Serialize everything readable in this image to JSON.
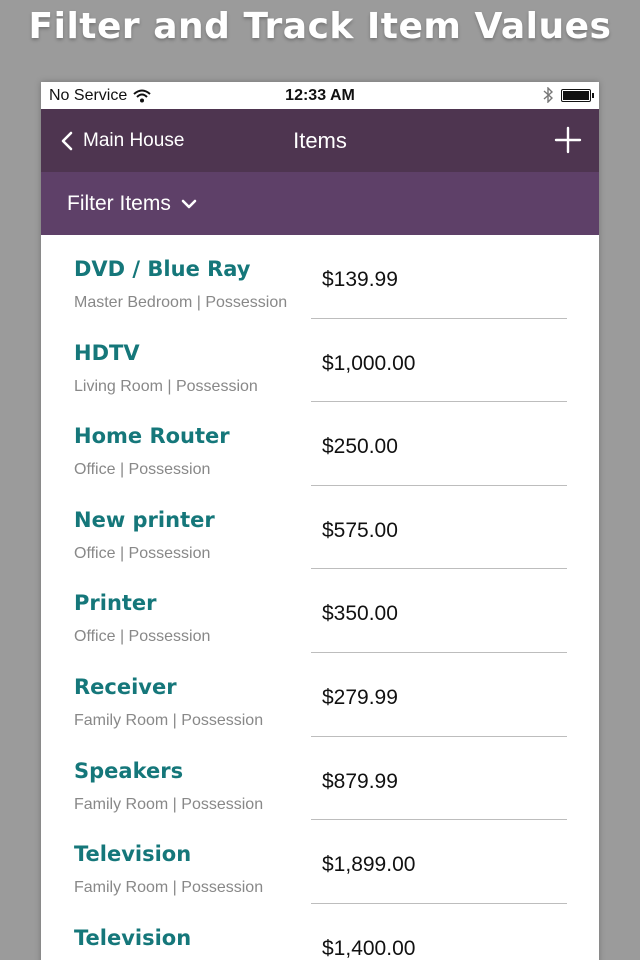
{
  "promo": {
    "headline": "Filter and Track Item Values"
  },
  "status_bar": {
    "carrier": "No Service",
    "time": "12:33 AM"
  },
  "nav": {
    "back_label": "Main House",
    "title": "Items"
  },
  "filter": {
    "label": "Filter Items"
  },
  "items": [
    {
      "name": "DVD / Blue Ray",
      "meta": "Master Bedroom | Possession",
      "value": "$139.99"
    },
    {
      "name": "HDTV",
      "meta": "Living Room | Possession",
      "value": "$1,000.00"
    },
    {
      "name": "Home Router",
      "meta": "Office | Possession",
      "value": "$250.00"
    },
    {
      "name": "New printer",
      "meta": "Office | Possession",
      "value": "$575.00"
    },
    {
      "name": "Printer",
      "meta": "Office | Possession",
      "value": "$350.00"
    },
    {
      "name": "Receiver",
      "meta": "Family Room | Possession",
      "value": "$279.99"
    },
    {
      "name": "Speakers",
      "meta": "Family Room | Possession",
      "value": "$879.99"
    },
    {
      "name": "Television",
      "meta": "Family Room | Possession",
      "value": "$1,899.00"
    },
    {
      "name": "Television",
      "meta": "",
      "value": "$1,400.00"
    }
  ],
  "colors": {
    "nav_background": "#4e3550",
    "filter_background": "#5e4068",
    "item_name": "#15777a",
    "page_background": "#9b9b9b"
  },
  "icons": [
    "wifi-icon",
    "bluetooth-icon",
    "battery-icon",
    "back-chevron-icon",
    "plus-icon",
    "chevron-down-icon"
  ]
}
